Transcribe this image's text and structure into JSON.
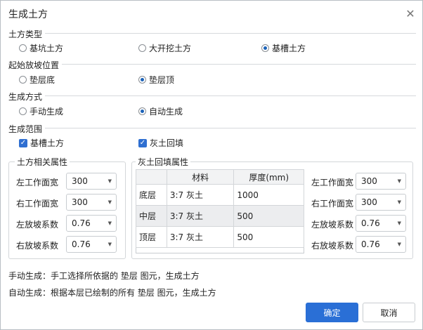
{
  "dialog": {
    "title": "生成土方",
    "close_icon": "close-icon"
  },
  "earthwork_type": {
    "label": "土方类型",
    "options": [
      "基坑土方",
      "大开挖土方",
      "基槽土方"
    ],
    "selected": "基槽土方"
  },
  "slope_start": {
    "label": "起始放坡位置",
    "options": [
      "垫层底",
      "垫层顶"
    ],
    "selected": "垫层顶"
  },
  "gen_method": {
    "label": "生成方式",
    "options": [
      "手动生成",
      "自动生成"
    ],
    "selected": "自动生成"
  },
  "gen_scope": {
    "label": "生成范围",
    "options": [
      "基槽土方",
      "灰土回填"
    ],
    "checked": [
      true,
      true
    ]
  },
  "earth_props": {
    "title": "土方相关属性",
    "rows": [
      {
        "label": "左工作面宽",
        "value": "300"
      },
      {
        "label": "右工作面宽",
        "value": "300"
      },
      {
        "label": "左放坡系数",
        "value": "0.76"
      },
      {
        "label": "右放坡系数",
        "value": "0.76"
      }
    ]
  },
  "backfill_props": {
    "title": "灰土回填属性",
    "headers": [
      "",
      "材料",
      "厚度(mm)"
    ],
    "rows": [
      {
        "layer": "底层",
        "material": "3:7 灰土",
        "thickness": "1000"
      },
      {
        "layer": "中层",
        "material": "3:7 灰土",
        "thickness": "500"
      },
      {
        "layer": "顶层",
        "material": "3:7 灰土",
        "thickness": "500"
      }
    ],
    "fields": [
      {
        "label": "左工作面宽",
        "value": "300"
      },
      {
        "label": "右工作面宽",
        "value": "300"
      },
      {
        "label": "左放坡系数",
        "value": "0.76"
      },
      {
        "label": "右放坡系数",
        "value": "0.76"
      }
    ]
  },
  "notes": {
    "manual": "手动生成：手工选择所依据的 垫层 图元，生成土方",
    "auto": "自动生成：根据本层已绘制的所有 垫层 图元，生成土方"
  },
  "buttons": {
    "ok": "确定",
    "cancel": "取消"
  },
  "colors": {
    "accent": "#2a6fd6",
    "radio_on": "#1b62b8"
  }
}
